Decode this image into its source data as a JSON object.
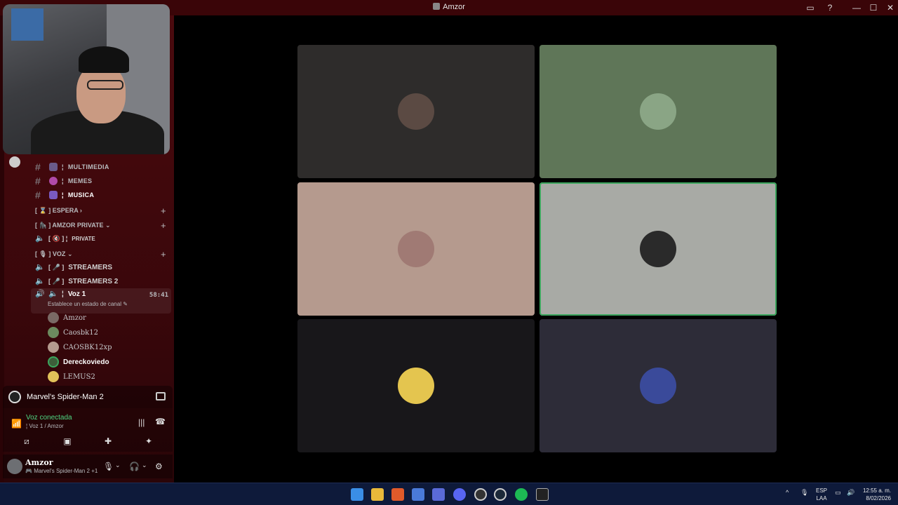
{
  "window": {
    "title": "Amzor"
  },
  "channels": {
    "text": [
      {
        "label": "MULTIMEDIA",
        "emoji_color": "#6a5b8a"
      },
      {
        "label": "MEMES",
        "emoji_color": "#b04aa8"
      },
      {
        "label": "MUSICA",
        "emoji_color": "#7a5ac0"
      }
    ],
    "categories": {
      "espera": "[ ⌛ ] ESPERA",
      "amzor_private": "[ 🦍 ] AMZOR PRIVATE",
      "voz": "[ 🎙 ] VOZ"
    },
    "private_channel": "PRIVATE",
    "voice": [
      {
        "label": "STREAMERS"
      },
      {
        "label": "STREAMERS 2"
      }
    ],
    "current_voice": {
      "label": "Voz 1",
      "timer": "58:41",
      "status": "Establece un estado de canal"
    },
    "members": [
      {
        "name": "Amzor",
        "color": "#7a6a65"
      },
      {
        "name": "Caosbk12",
        "color": "#6c8a5e"
      },
      {
        "name": "CAOSBK12xp",
        "color": "#b59a8e"
      },
      {
        "name": "Dereckoviedo",
        "color": "#3d5e3a"
      },
      {
        "name": "LEMUS2",
        "color": "#e1c25a"
      }
    ]
  },
  "activity": {
    "game": "Marvel's Spider-Man 2"
  },
  "voice_status": {
    "title": "Voz conectada",
    "subtitle": "Voz 1 / Amzor"
  },
  "user": {
    "name": "Amzor",
    "status": "Marvel's Spider-Man 2 +1"
  },
  "tiles": [
    {
      "bg": "#2e2c2b",
      "avatar": "#5b4a43",
      "speaking": false
    },
    {
      "bg": "#5f7658",
      "avatar": "#8aa585",
      "speaking": false
    },
    {
      "bg": "#b59a8e",
      "avatar": "#a07a74",
      "speaking": false
    },
    {
      "bg": "#a8aaa5",
      "avatar": "#2a2a2a",
      "speaking": true
    },
    {
      "bg": "#18171a",
      "avatar": "#e4c54f",
      "speaking": false
    },
    {
      "bg": "#2d2c38",
      "avatar": "#3a4a9a",
      "speaking": false
    }
  ],
  "taskbar": {
    "lang_top": "ESP",
    "lang_bottom": "LAA",
    "time": "12:55 a. m.",
    "date": "8/02/2026"
  }
}
